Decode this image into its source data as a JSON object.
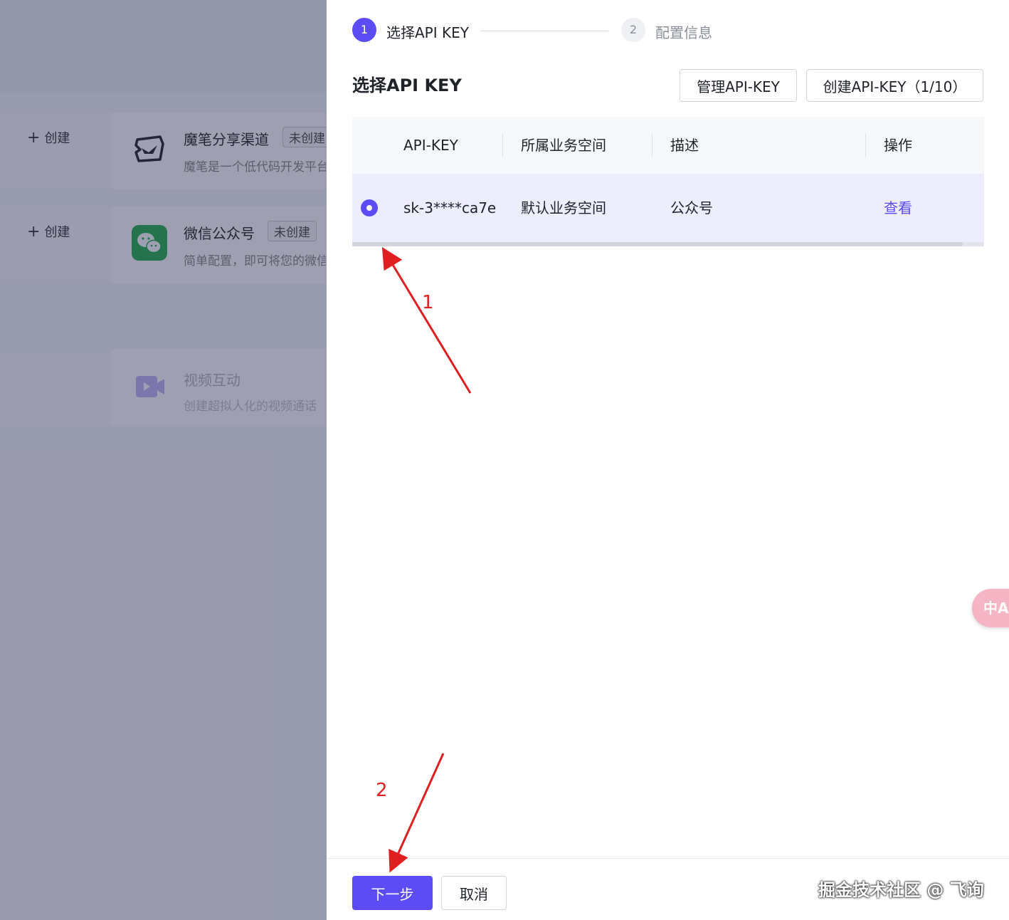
{
  "background": {
    "rows": [
      {
        "create_label": "创建",
        "title": "魔笔分享渠道",
        "tag": "未创建",
        "desc": "魔笔是一个低代码开发平台"
      },
      {
        "create_label": "创建",
        "title": "微信公众号",
        "tag": "未创建",
        "desc": "简单配置，即可将您的微信"
      },
      {
        "title": "视频互动",
        "desc": "创建超拟人化的视频通话"
      }
    ]
  },
  "steps": [
    {
      "number": "1",
      "label": "选择API KEY",
      "state": "active"
    },
    {
      "number": "2",
      "label": "配置信息",
      "state": "inactive"
    }
  ],
  "section": {
    "title": "选择API KEY",
    "manage_button": "管理API-KEY",
    "create_button": "创建API-KEY（1/10）"
  },
  "table": {
    "columns": [
      "API-KEY",
      "所属业务空间",
      "描述",
      "操作"
    ],
    "rows": [
      {
        "selected": true,
        "api_key": "sk-3****ca7e",
        "workspace": "默认业务空间",
        "description": "公众号",
        "action": "查看"
      }
    ]
  },
  "footer": {
    "next_button": "下一步",
    "cancel_button": "取消"
  },
  "translate_button": "中A",
  "annotations": {
    "label_1": "1",
    "label_2": "2"
  },
  "watermark": "掘金技术社区 @ 飞询",
  "colors": {
    "accent": "#5b4cf6",
    "annotation": "#e02020",
    "selected_row": "#eeedfd"
  }
}
